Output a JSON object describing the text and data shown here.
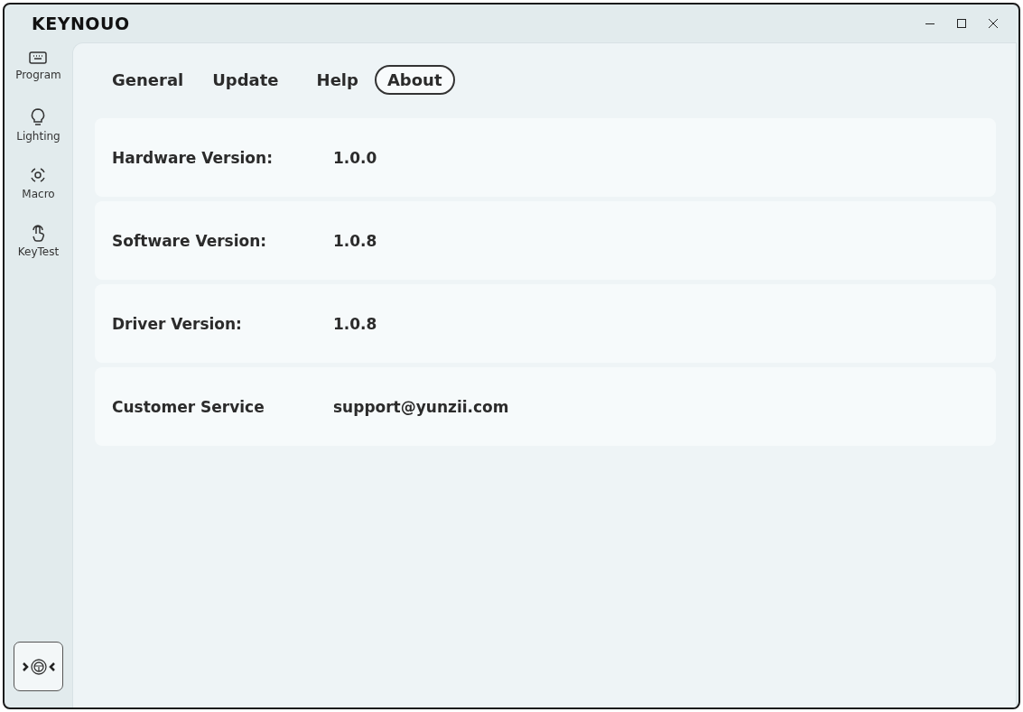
{
  "window": {
    "title": "KEYNOUO"
  },
  "sidebar": {
    "items": [
      {
        "label": "Program"
      },
      {
        "label": "Lighting"
      },
      {
        "label": "Macro"
      },
      {
        "label": "KeyTest"
      }
    ]
  },
  "tabs": [
    {
      "label": "General",
      "selected": false
    },
    {
      "label": "Update",
      "selected": false
    },
    {
      "label": "Help",
      "selected": false
    },
    {
      "label": "About",
      "selected": true
    }
  ],
  "info_rows": [
    {
      "label": "Hardware Version:",
      "value": "1.0.0"
    },
    {
      "label": "Software Version:",
      "value": "1.0.8"
    },
    {
      "label": "Driver Version:",
      "value": "1.0.8"
    },
    {
      "label": "Customer Service",
      "value": "support@yunzii.com"
    }
  ]
}
